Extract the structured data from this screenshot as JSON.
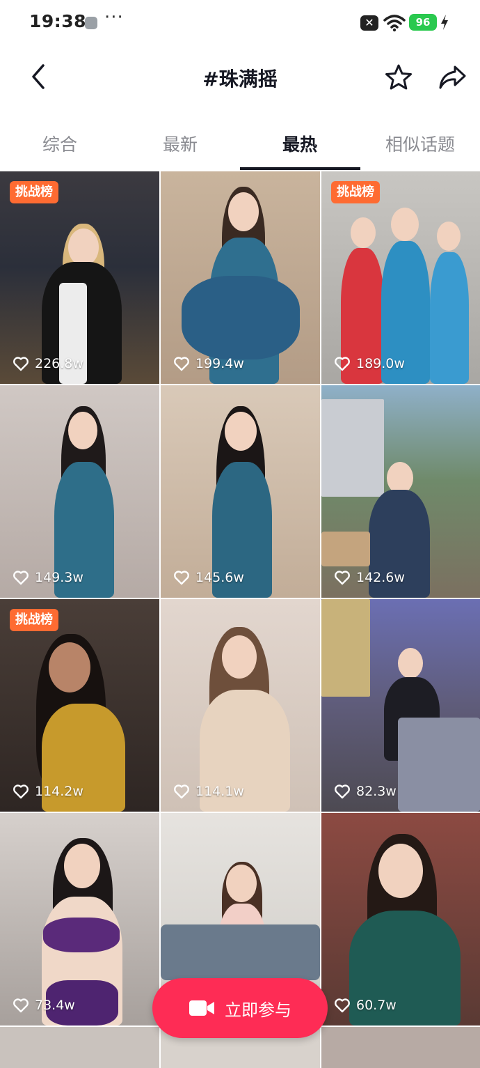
{
  "status_bar": {
    "time": "19:38",
    "more": "···",
    "battery": "96",
    "icons": [
      "app-icon",
      "x-notification-icon",
      "wifi-icon",
      "battery-icon",
      "charging-icon"
    ]
  },
  "header": {
    "title": "#珠满摇",
    "icons": [
      "back-arrow-icon",
      "star-icon",
      "share-icon"
    ]
  },
  "tabs": [
    {
      "label": "综合",
      "active": false
    },
    {
      "label": "最新",
      "active": false
    },
    {
      "label": "最热",
      "active": true
    },
    {
      "label": "相似话题",
      "active": false
    }
  ],
  "videos": [
    {
      "likes": "226.8w",
      "badge": "挑战榜"
    },
    {
      "likes": "199.4w",
      "badge": ""
    },
    {
      "likes": "189.0w",
      "badge": "挑战榜"
    },
    {
      "likes": "149.3w",
      "badge": ""
    },
    {
      "likes": "145.6w",
      "badge": ""
    },
    {
      "likes": "142.6w",
      "badge": ""
    },
    {
      "likes": "114.2w",
      "badge": "挑战榜"
    },
    {
      "likes": "114.1w",
      "badge": ""
    },
    {
      "likes": "82.3w",
      "badge": ""
    },
    {
      "likes": "73.4w",
      "badge": ""
    },
    {
      "likes": "",
      "badge": ""
    },
    {
      "likes": "60.7w",
      "badge": ""
    }
  ],
  "join_button": {
    "label": "立即参与",
    "icon": "video-camera-icon"
  },
  "colors": {
    "accent": "#fe2c55",
    "badge": "#fe6b32",
    "battery": "#2ac94f"
  }
}
